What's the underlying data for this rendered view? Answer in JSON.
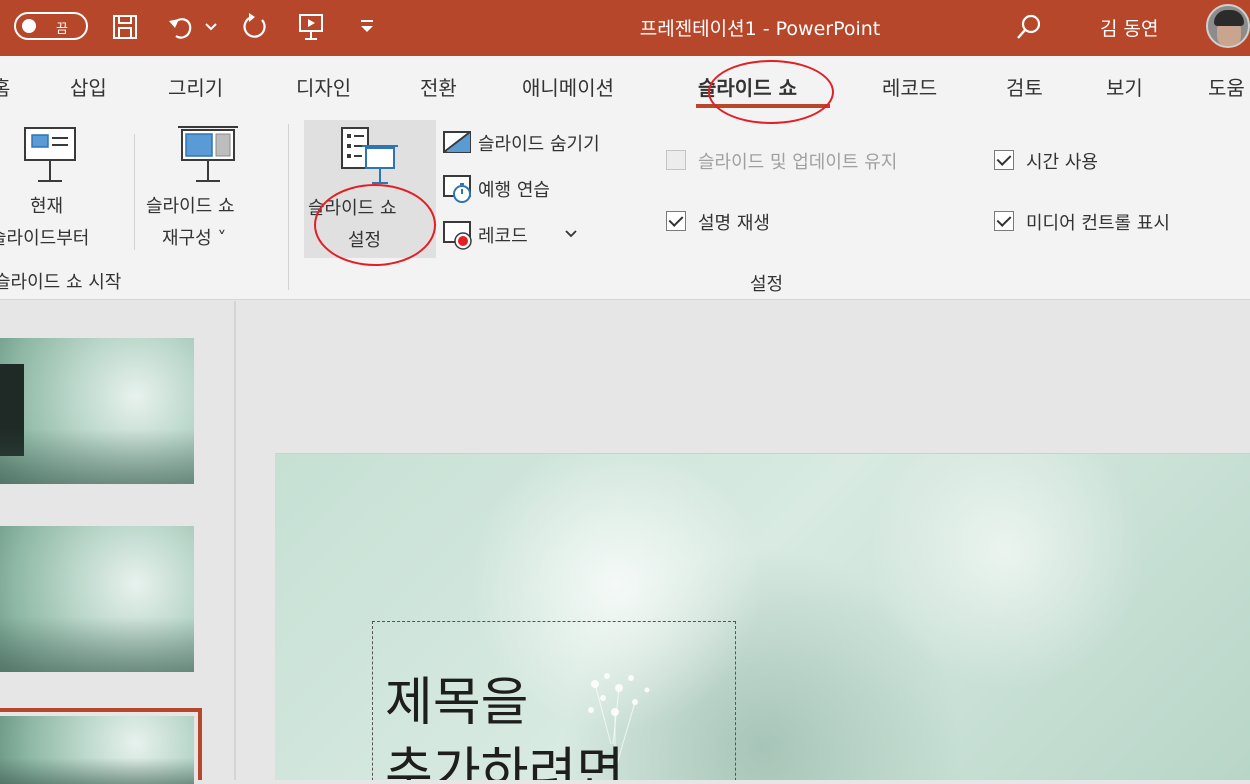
{
  "titlebar": {
    "autosave_label": "끔",
    "doc_title": "프레젠테이션1  -  PowerPoint",
    "user_name": "김 동연"
  },
  "tabs": [
    {
      "label": "홈"
    },
    {
      "label": "삽입"
    },
    {
      "label": "그리기"
    },
    {
      "label": "디자인"
    },
    {
      "label": "전환"
    },
    {
      "label": "애니메이션"
    },
    {
      "label": "슬라이드 쇼",
      "active": true
    },
    {
      "label": "레코드"
    },
    {
      "label": "검토"
    },
    {
      "label": "보기"
    },
    {
      "label": "도움"
    }
  ],
  "ribbon": {
    "start_group": {
      "from_current_line1": "현재",
      "from_current_line2": "슬라이드부터",
      "custom_line1": "슬라이드 쇼",
      "custom_line2": "재구성 ˅",
      "group_label": "슬라이드 쇼 시작"
    },
    "setup_group": {
      "setup_line1": "슬라이드 쇼",
      "setup_line2": "설정",
      "hide_slide": "슬라이드 숨기기",
      "rehearse": "예행 연습",
      "record": "레코드",
      "keep_updated": "슬라이드 및 업데이트 유지",
      "play_narrations": "설명 재생",
      "use_timings": "시간 사용",
      "show_media_controls": "미디어 컨트롤 표시",
      "group_label": "설정"
    }
  },
  "slide": {
    "title_line1": "제목을",
    "title_line2": "추가하려면"
  },
  "colors": {
    "accent": "#b7472a",
    "ribbon_bg": "#f3f3f3",
    "annotation": "#e31e24"
  }
}
